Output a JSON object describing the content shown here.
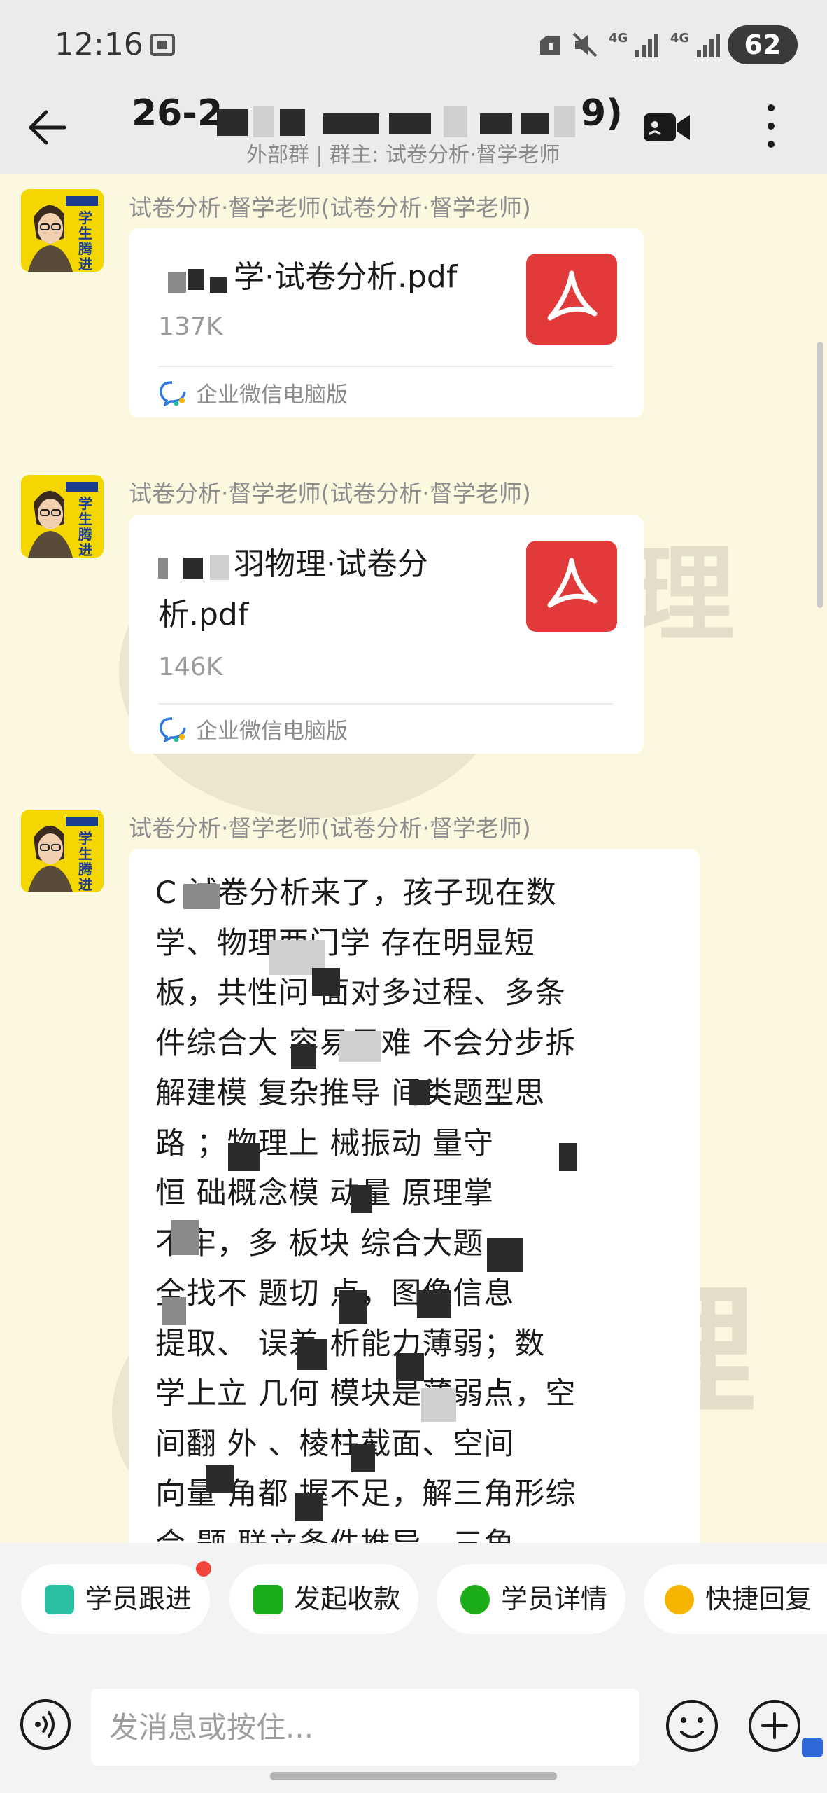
{
  "status_bar": {
    "time": "12:16",
    "network_1": "4G",
    "network_2": "4G",
    "battery": "62"
  },
  "header": {
    "title_visible_start": "26-2",
    "title_visible_end": "9)",
    "subtitle": "外部群 | 群主: 试卷分析·督学老师"
  },
  "messages": [
    {
      "sender": "试卷分析·督学老师(试卷分析·督学老师)",
      "file_name": "学·试卷分析.pdf",
      "file_size": "137K",
      "source": "企业微信电脑版"
    },
    {
      "sender": "试卷分析·督学老师(试卷分析·督学老师)",
      "file_name_line1": "羽物理·试卷分",
      "file_name_line2": "析.pdf",
      "file_size": "146K",
      "source": "企业微信电脑版"
    },
    {
      "sender": "试卷分析·督学老师(试卷分析·督学老师)",
      "lines": [
        "C   试卷分析来了，孩子现在数",
        "学、物理两门学   存在明显短",
        "板，共性问   面对多过程、多条",
        "件综合大   容易畏难   不会分步拆",
        "解建模   复杂推导   间类题型思",
        "路   ；物理上   械振动   量守",
        "恒   础概念模   动量   原理掌",
        "   不牢，多   板块   综合大题",
        "   全找不   题切   点，图像信息",
        "提取、   误差   析能力薄弱；数",
        "学上立   几何   模块是薄弱点，空",
        "间翻   外   、棱柱截面、空间",
        "向量   角都   握不足，解三角形综",
        "合   题   联立条件推导、三角"
      ]
    }
  ],
  "avatar_text": "学生腾进",
  "watermark_char": "理",
  "actions": [
    {
      "label": "学员跟进",
      "icon": "follow-up-icon",
      "color": "#2bbfa4"
    },
    {
      "label": "发起收款",
      "icon": "payment-icon",
      "color": "#1aad19"
    },
    {
      "label": "学员详情",
      "icon": "student-detail-icon",
      "color": "#1aad19"
    },
    {
      "label": "快捷回复",
      "icon": "quick-reply-icon",
      "color": "#f5b400"
    }
  ],
  "input": {
    "placeholder": "发消息或按住..."
  }
}
